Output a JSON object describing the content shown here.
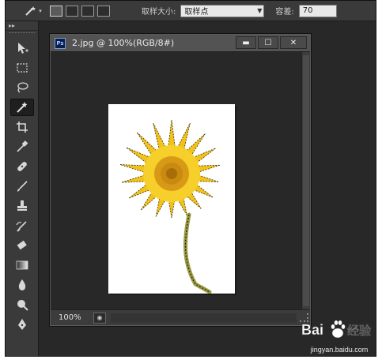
{
  "options_bar": {
    "sample_size_label": "取样大小:",
    "sample_size_value": "取样点",
    "tolerance_label": "容差:",
    "tolerance_value": "70"
  },
  "toolbar": {
    "collapse": "▸▸",
    "tools": [
      {
        "name": "move-tool"
      },
      {
        "name": "marquee-tool"
      },
      {
        "name": "lasso-tool"
      },
      {
        "name": "magic-wand-tool",
        "active": true
      },
      {
        "name": "crop-tool"
      },
      {
        "name": "eyedropper-tool"
      },
      {
        "name": "spot-healing-tool"
      },
      {
        "name": "brush-tool"
      },
      {
        "name": "clone-stamp-tool"
      },
      {
        "name": "history-brush-tool"
      },
      {
        "name": "eraser-tool"
      },
      {
        "name": "gradient-tool"
      },
      {
        "name": "blur-tool"
      },
      {
        "name": "dodge-tool"
      },
      {
        "name": "pen-tool"
      }
    ]
  },
  "document": {
    "icon_text": "Ps",
    "title": "2.jpg @ 100%(RGB/8#)",
    "minimize": "▬",
    "maximize": "☐",
    "close": "✕",
    "zoom": "100%"
  },
  "watermark": {
    "url": "jingyan.baidu.com",
    "logo_text": "Bai du 经验"
  },
  "colors": {
    "flower_petal": "#f2c21a",
    "flower_center": "#c98a10",
    "stem": "#9a9a40"
  }
}
